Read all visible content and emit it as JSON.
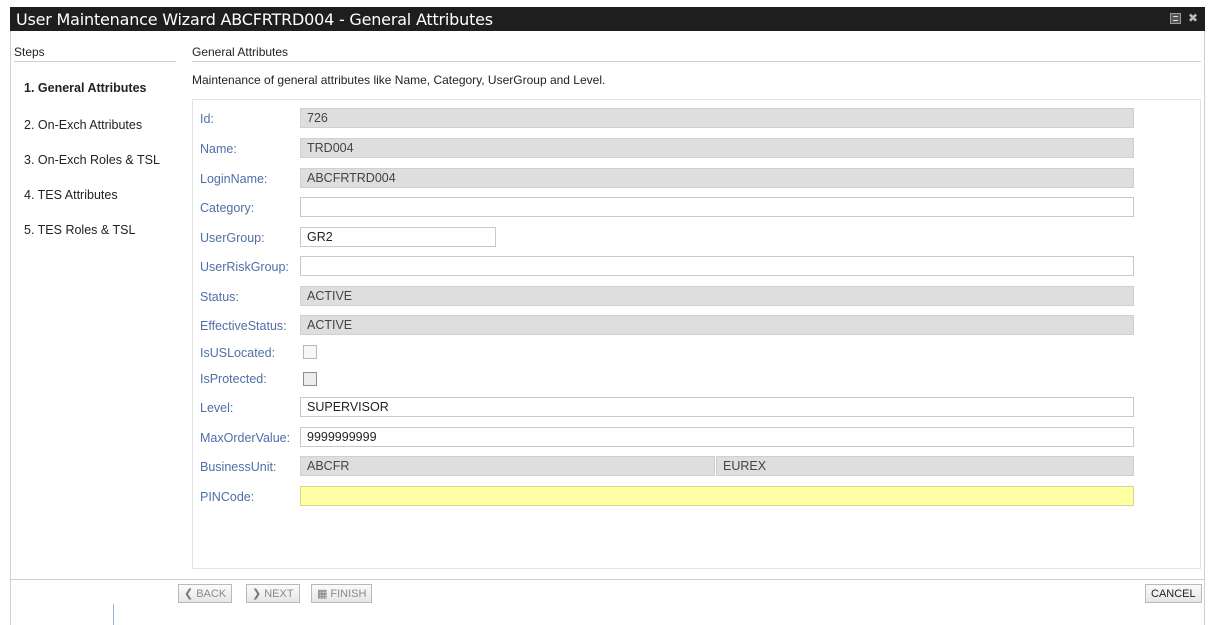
{
  "window": {
    "title": "User Maintenance Wizard ABCFRTRD004 - General Attributes",
    "restore_icon": "restore-window-icon",
    "close_icon": "close-icon"
  },
  "steps": {
    "header": "Steps",
    "items": [
      {
        "label": "1. General Attributes",
        "active": true
      },
      {
        "label": "2. On-Exch Attributes",
        "active": false
      },
      {
        "label": "3. On-Exch Roles & TSL",
        "active": false
      },
      {
        "label": "4. TES Attributes",
        "active": false
      },
      {
        "label": "5. TES Roles & TSL",
        "active": false
      }
    ]
  },
  "main": {
    "header": "General Attributes",
    "description": "Maintenance of general attributes like Name, Category, UserGroup and Level."
  },
  "form": {
    "id": {
      "label": "Id:",
      "value": "726"
    },
    "name": {
      "label": "Name:",
      "value": "TRD004"
    },
    "login_name": {
      "label": "LoginName:",
      "value": "ABCFRTRD004"
    },
    "category": {
      "label": "Category:",
      "value": ""
    },
    "user_group": {
      "label": "UserGroup:",
      "value": "GR2"
    },
    "user_risk_group": {
      "label": "UserRiskGroup:",
      "value": ""
    },
    "status": {
      "label": "Status:",
      "value": "ACTIVE"
    },
    "effective_status": {
      "label": "EffectiveStatus:",
      "value": "ACTIVE"
    },
    "is_us_located": {
      "label": "IsUSLocated:",
      "checked": false
    },
    "is_protected": {
      "label": "IsProtected:",
      "checked": false
    },
    "level": {
      "label": "Level:",
      "value": "SUPERVISOR"
    },
    "max_order_value": {
      "label": "MaxOrderValue:",
      "value": "9999999999"
    },
    "business_unit": {
      "label": "BusinessUnit:",
      "value": "ABCFR",
      "value2": "EUREX"
    },
    "pin_code": {
      "label": "PINCode:",
      "value": ""
    }
  },
  "footer": {
    "back": {
      "label": "BACK",
      "icon": "chevron-left-icon"
    },
    "next": {
      "label": "NEXT",
      "icon": "chevron-right-icon"
    },
    "finish": {
      "label": "FINISH",
      "icon": "checkered-flag-icon"
    },
    "cancel": {
      "label": "CANCEL"
    }
  },
  "colors": {
    "titlebar": "#1e1e1e",
    "label": "#4f6fa8",
    "readonly_field": "#dedede",
    "pin_field": "#ffffa6"
  }
}
